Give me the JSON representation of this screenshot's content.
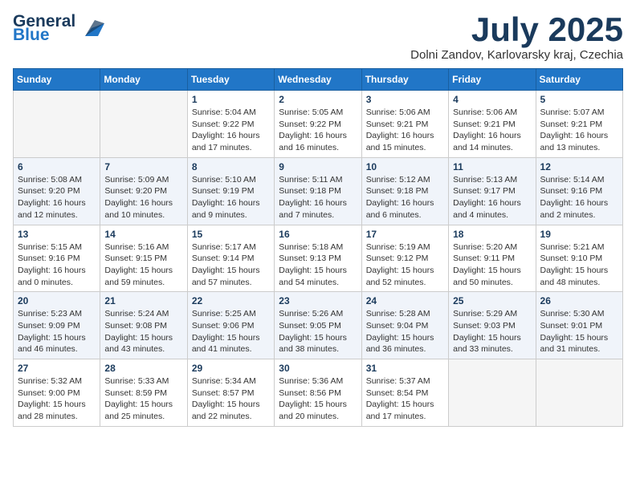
{
  "header": {
    "logo_general": "General",
    "logo_blue": "Blue",
    "month_title": "July 2025",
    "location": "Dolni Zandov, Karlovarsky kraj, Czechia"
  },
  "days_of_week": [
    "Sunday",
    "Monday",
    "Tuesday",
    "Wednesday",
    "Thursday",
    "Friday",
    "Saturday"
  ],
  "weeks": [
    [
      {
        "day": "",
        "info": ""
      },
      {
        "day": "",
        "info": ""
      },
      {
        "day": "1",
        "info": "Sunrise: 5:04 AM\nSunset: 9:22 PM\nDaylight: 16 hours and 17 minutes."
      },
      {
        "day": "2",
        "info": "Sunrise: 5:05 AM\nSunset: 9:22 PM\nDaylight: 16 hours and 16 minutes."
      },
      {
        "day": "3",
        "info": "Sunrise: 5:06 AM\nSunset: 9:21 PM\nDaylight: 16 hours and 15 minutes."
      },
      {
        "day": "4",
        "info": "Sunrise: 5:06 AM\nSunset: 9:21 PM\nDaylight: 16 hours and 14 minutes."
      },
      {
        "day": "5",
        "info": "Sunrise: 5:07 AM\nSunset: 9:21 PM\nDaylight: 16 hours and 13 minutes."
      }
    ],
    [
      {
        "day": "6",
        "info": "Sunrise: 5:08 AM\nSunset: 9:20 PM\nDaylight: 16 hours and 12 minutes."
      },
      {
        "day": "7",
        "info": "Sunrise: 5:09 AM\nSunset: 9:20 PM\nDaylight: 16 hours and 10 minutes."
      },
      {
        "day": "8",
        "info": "Sunrise: 5:10 AM\nSunset: 9:19 PM\nDaylight: 16 hours and 9 minutes."
      },
      {
        "day": "9",
        "info": "Sunrise: 5:11 AM\nSunset: 9:18 PM\nDaylight: 16 hours and 7 minutes."
      },
      {
        "day": "10",
        "info": "Sunrise: 5:12 AM\nSunset: 9:18 PM\nDaylight: 16 hours and 6 minutes."
      },
      {
        "day": "11",
        "info": "Sunrise: 5:13 AM\nSunset: 9:17 PM\nDaylight: 16 hours and 4 minutes."
      },
      {
        "day": "12",
        "info": "Sunrise: 5:14 AM\nSunset: 9:16 PM\nDaylight: 16 hours and 2 minutes."
      }
    ],
    [
      {
        "day": "13",
        "info": "Sunrise: 5:15 AM\nSunset: 9:16 PM\nDaylight: 16 hours and 0 minutes."
      },
      {
        "day": "14",
        "info": "Sunrise: 5:16 AM\nSunset: 9:15 PM\nDaylight: 15 hours and 59 minutes."
      },
      {
        "day": "15",
        "info": "Sunrise: 5:17 AM\nSunset: 9:14 PM\nDaylight: 15 hours and 57 minutes."
      },
      {
        "day": "16",
        "info": "Sunrise: 5:18 AM\nSunset: 9:13 PM\nDaylight: 15 hours and 54 minutes."
      },
      {
        "day": "17",
        "info": "Sunrise: 5:19 AM\nSunset: 9:12 PM\nDaylight: 15 hours and 52 minutes."
      },
      {
        "day": "18",
        "info": "Sunrise: 5:20 AM\nSunset: 9:11 PM\nDaylight: 15 hours and 50 minutes."
      },
      {
        "day": "19",
        "info": "Sunrise: 5:21 AM\nSunset: 9:10 PM\nDaylight: 15 hours and 48 minutes."
      }
    ],
    [
      {
        "day": "20",
        "info": "Sunrise: 5:23 AM\nSunset: 9:09 PM\nDaylight: 15 hours and 46 minutes."
      },
      {
        "day": "21",
        "info": "Sunrise: 5:24 AM\nSunset: 9:08 PM\nDaylight: 15 hours and 43 minutes."
      },
      {
        "day": "22",
        "info": "Sunrise: 5:25 AM\nSunset: 9:06 PM\nDaylight: 15 hours and 41 minutes."
      },
      {
        "day": "23",
        "info": "Sunrise: 5:26 AM\nSunset: 9:05 PM\nDaylight: 15 hours and 38 minutes."
      },
      {
        "day": "24",
        "info": "Sunrise: 5:28 AM\nSunset: 9:04 PM\nDaylight: 15 hours and 36 minutes."
      },
      {
        "day": "25",
        "info": "Sunrise: 5:29 AM\nSunset: 9:03 PM\nDaylight: 15 hours and 33 minutes."
      },
      {
        "day": "26",
        "info": "Sunrise: 5:30 AM\nSunset: 9:01 PM\nDaylight: 15 hours and 31 minutes."
      }
    ],
    [
      {
        "day": "27",
        "info": "Sunrise: 5:32 AM\nSunset: 9:00 PM\nDaylight: 15 hours and 28 minutes."
      },
      {
        "day": "28",
        "info": "Sunrise: 5:33 AM\nSunset: 8:59 PM\nDaylight: 15 hours and 25 minutes."
      },
      {
        "day": "29",
        "info": "Sunrise: 5:34 AM\nSunset: 8:57 PM\nDaylight: 15 hours and 22 minutes."
      },
      {
        "day": "30",
        "info": "Sunrise: 5:36 AM\nSunset: 8:56 PM\nDaylight: 15 hours and 20 minutes."
      },
      {
        "day": "31",
        "info": "Sunrise: 5:37 AM\nSunset: 8:54 PM\nDaylight: 15 hours and 17 minutes."
      },
      {
        "day": "",
        "info": ""
      },
      {
        "day": "",
        "info": ""
      }
    ]
  ]
}
